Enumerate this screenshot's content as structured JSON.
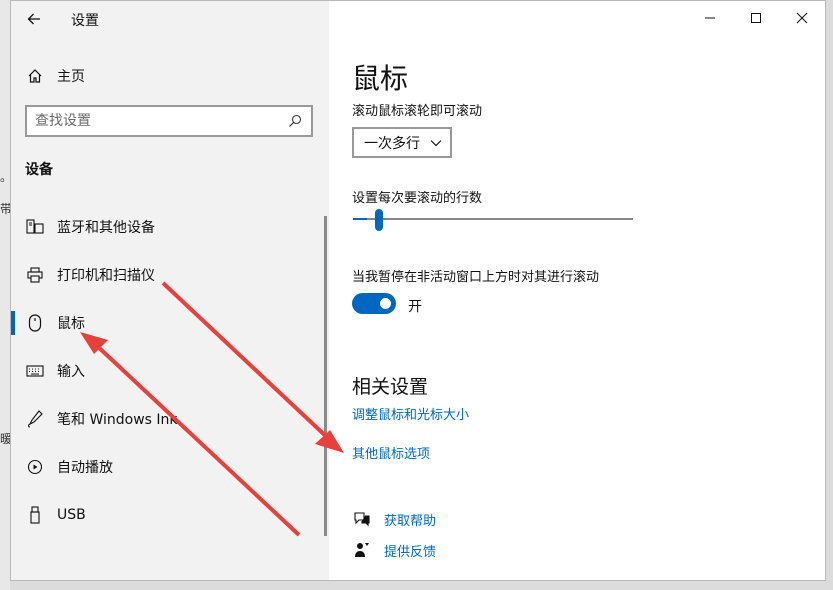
{
  "background": {
    "fragments": [
      "。",
      "带",
      "暖"
    ]
  },
  "window": {
    "title": "设置",
    "controls": [
      "minimize-icon",
      "maximize-icon",
      "close-icon"
    ]
  },
  "sidebar": {
    "home_label": "主页",
    "search_placeholder": "查找设置",
    "section_title": "设备",
    "items": [
      {
        "label": "蓝牙和其他设备",
        "icon": "bluetooth-devices-icon",
        "selected": false
      },
      {
        "label": "打印机和扫描仪",
        "icon": "printer-icon",
        "selected": false
      },
      {
        "label": "鼠标",
        "icon": "mouse-icon",
        "selected": true
      },
      {
        "label": "输入",
        "icon": "keyboard-icon",
        "selected": false
      },
      {
        "label": "笔和 Windows Ink",
        "icon": "pen-icon",
        "selected": false
      },
      {
        "label": "自动播放",
        "icon": "autoplay-icon",
        "selected": false
      },
      {
        "label": "USB",
        "icon": "usb-icon",
        "selected": false
      }
    ]
  },
  "main": {
    "page_title": "鼠标",
    "scroll_wheel_label": "滚动鼠标滚轮即可滚动",
    "scroll_wheel_value": "一次多行",
    "lines_label": "设置每次要滚动的行数",
    "lines_slider_fraction": 0.05,
    "inactive_scroll_label": "当我暂停在非活动窗口上方时对其进行滚动",
    "inactive_scroll_state": "开",
    "related_title": "相关设置",
    "related_links": [
      "调整鼠标和光标大小",
      "其他鼠标选项"
    ],
    "help_label": "获取帮助",
    "feedback_label": "提供反馈"
  },
  "annotation": {
    "arrow_color": "#e8403a"
  },
  "colors": {
    "accent": "#0067c0",
    "sidebar_bg": "#f2f2f2"
  }
}
